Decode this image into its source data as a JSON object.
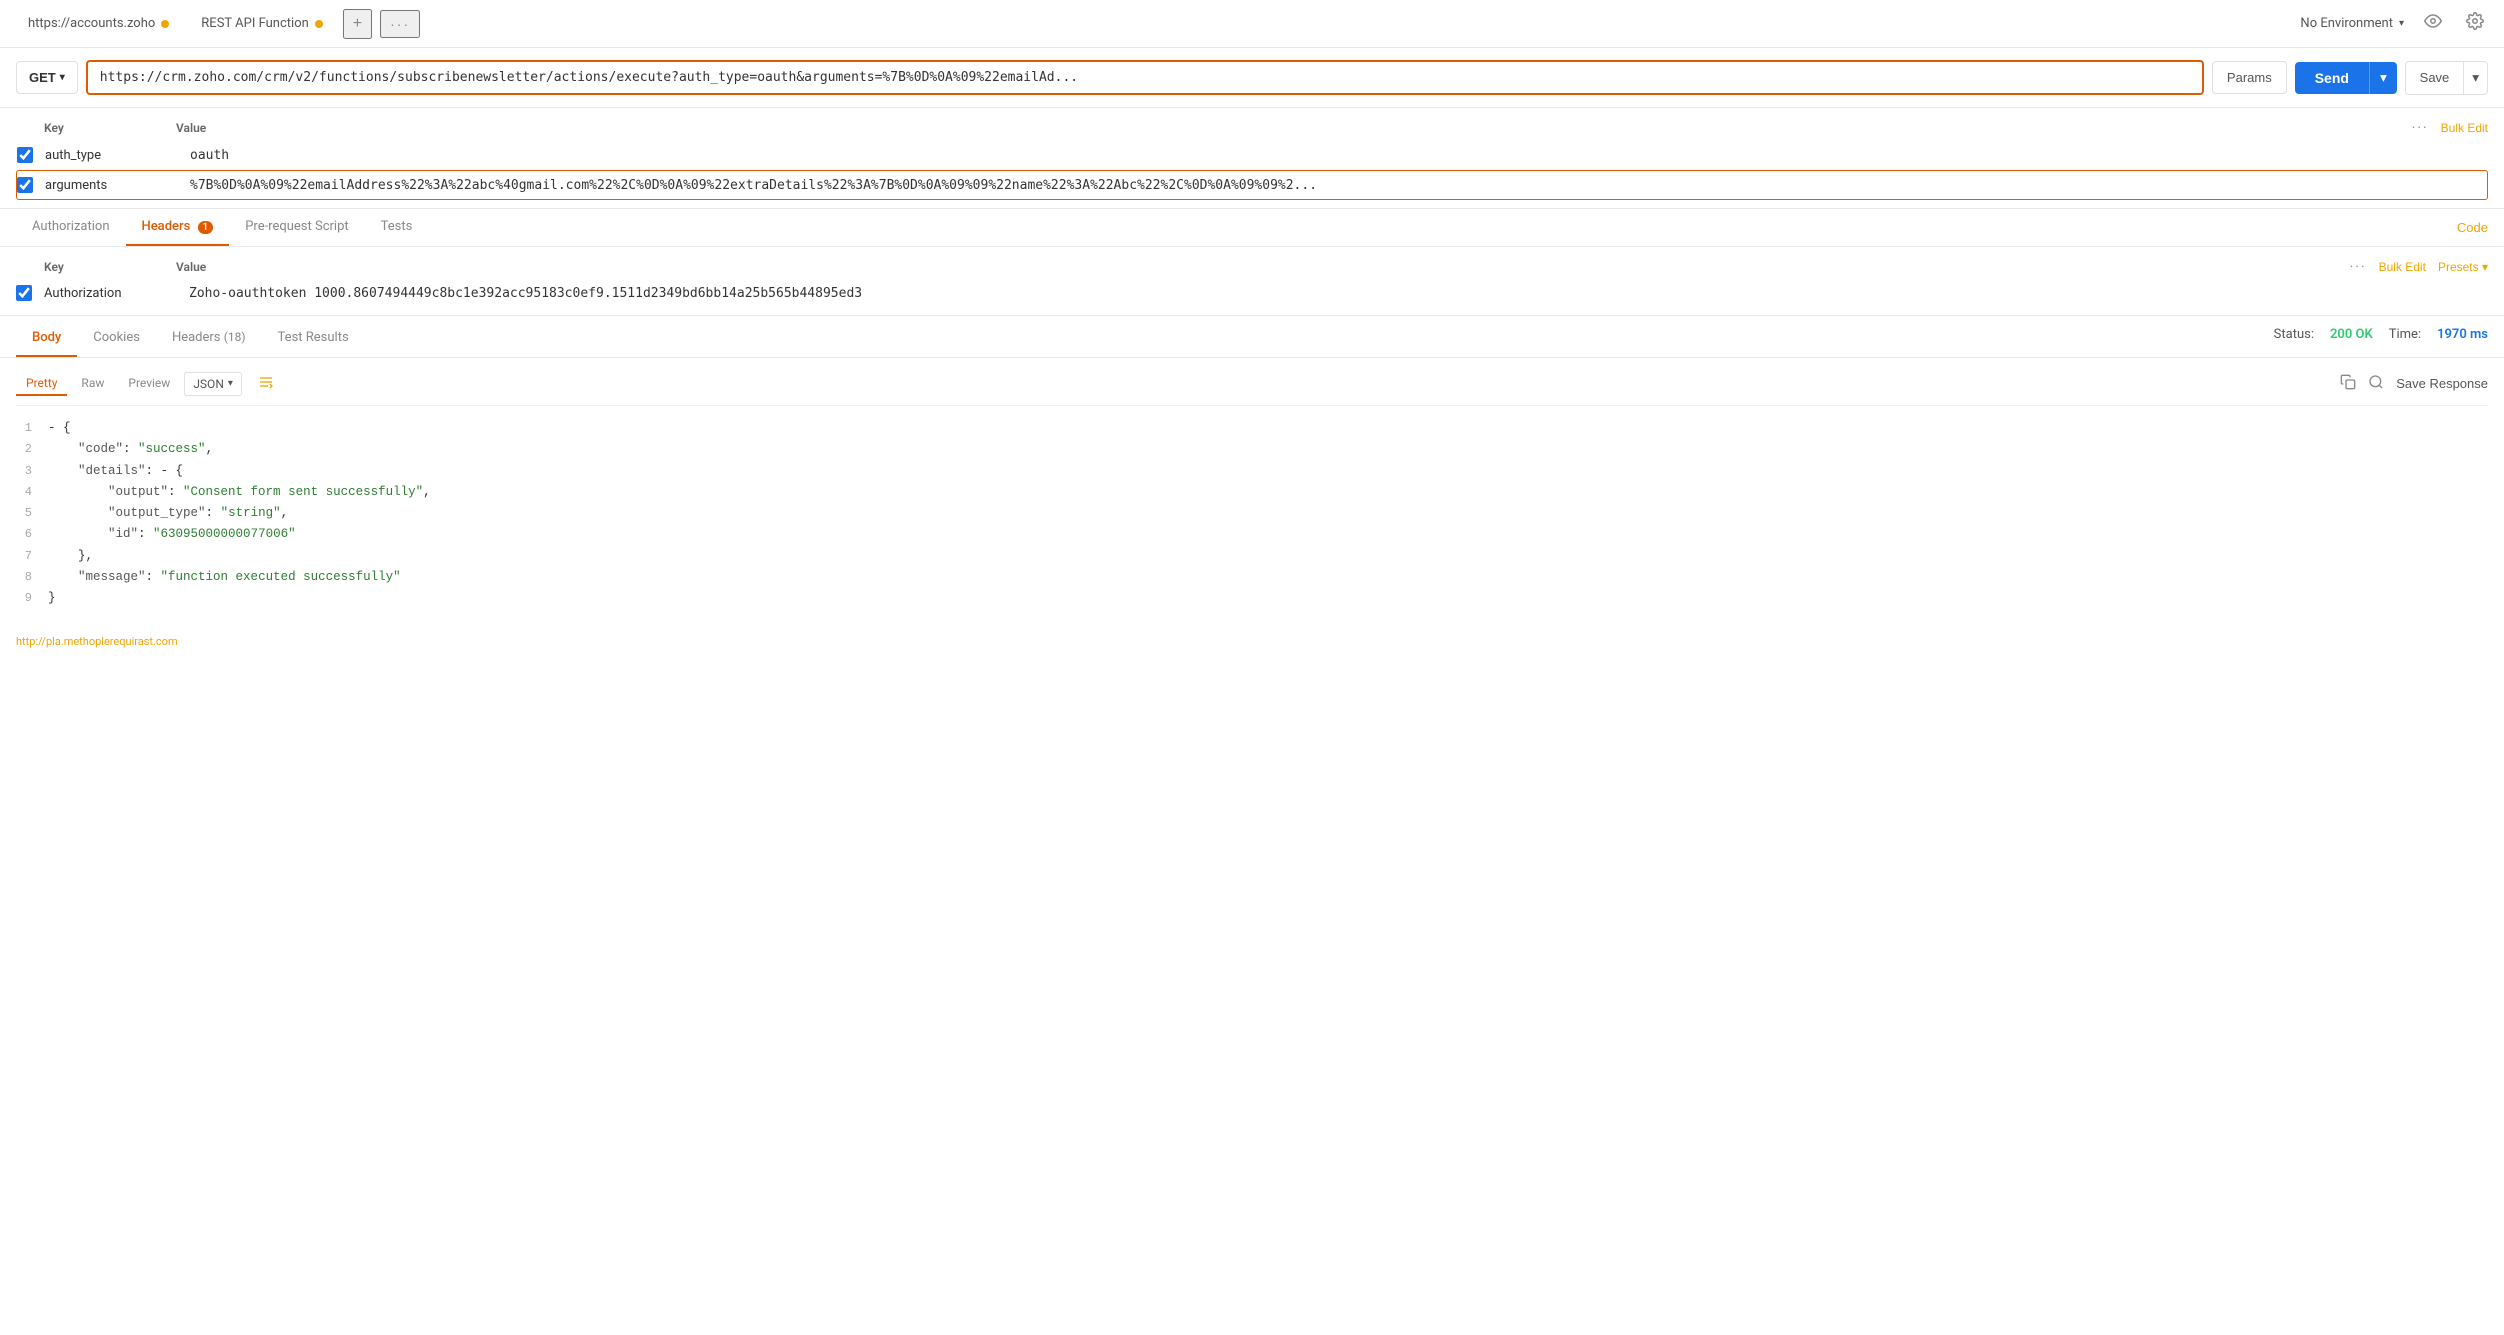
{
  "topBar": {
    "tab1": {
      "label": "https://accounts.zoho",
      "dotColor": "#f0a500"
    },
    "tab2": {
      "label": "REST API Function",
      "dotColor": "#f0a500"
    },
    "addIcon": "+",
    "moreIcon": "···",
    "envSelector": "No Environment",
    "eyeIcon": "👁",
    "gearIcon": "⚙"
  },
  "urlBar": {
    "method": "GET",
    "url": "https://crm.zoho.com/crm/v2/functions/subscribenewsletter/actions/execute?auth_type=oauth&arguments=%7B%0D%0A%09%22emailAd...",
    "paramsBtn": "Params",
    "sendBtn": "Send",
    "saveBtn": "Save"
  },
  "paramsTable": {
    "keyHeader": "Key",
    "valueHeader": "Value",
    "moreIcon": "···",
    "bulkEditBtn": "Bulk Edit",
    "rows": [
      {
        "checked": true,
        "key": "auth_type",
        "value": "oauth",
        "highlighted": false
      },
      {
        "checked": true,
        "key": "arguments",
        "value": "%7B%0D%0A%09%22emailAddress%22%3A%22abc%40gmail.com%22%2C%0D%0A%09%22extraDetails%22%3A%7B%0D%0A%09%09%22name%22%3A%22Abc%22%2C%0D%0A%09%09%2...",
        "highlighted": true
      }
    ]
  },
  "requestTabs": {
    "authorization": "Authorization",
    "headers": "Headers",
    "headersCount": "(1)",
    "preRequestScript": "Pre-request Script",
    "tests": "Tests",
    "activeTab": "headers",
    "codeBtn": "Code"
  },
  "headersTable": {
    "keyHeader": "Key",
    "valueHeader": "Value",
    "moreIcon": "···",
    "bulkEditBtn": "Bulk Edit",
    "presetsBtn": "Presets",
    "rows": [
      {
        "checked": true,
        "key": "Authorization",
        "value": "Zoho-oauthtoken 1000.8607494449c8bc1e392acc95183c0ef9.1511d2349bd6bb14a25b565b44895ed3"
      }
    ]
  },
  "responseTabs": {
    "body": "Body",
    "cookies": "Cookies",
    "headers": "Headers",
    "headersCount": "(18)",
    "testResults": "Test Results",
    "activeTab": "body",
    "statusLabel": "Status:",
    "statusValue": "200 OK",
    "timeLabel": "Time:",
    "timeValue": "1970 ms"
  },
  "responseFormatBar": {
    "pretty": "Pretty",
    "raw": "Raw",
    "preview": "Preview",
    "jsonFormat": "JSON",
    "wrapIcon": "≡",
    "copyIcon": "⧉",
    "searchIcon": "🔍",
    "saveResponse": "Save Response"
  },
  "codeLines": [
    {
      "num": "1",
      "content": "{",
      "type": "brace"
    },
    {
      "num": "2",
      "content": "    \"code\": \"success\",",
      "type": "keystring"
    },
    {
      "num": "3",
      "content": "    \"details\": {",
      "type": "keyobject"
    },
    {
      "num": "4",
      "content": "        \"output\": \"Consent form sent successfully\",",
      "type": "keystring"
    },
    {
      "num": "5",
      "content": "        \"output_type\": \"string\",",
      "type": "keystring"
    },
    {
      "num": "6",
      "content": "        \"id\": \"63095000000077006\"",
      "type": "keystring"
    },
    {
      "num": "7",
      "content": "    },",
      "type": "brace"
    },
    {
      "num": "8",
      "content": "    \"message\": \"function executed successfully\"",
      "type": "keystring"
    },
    {
      "num": "9",
      "content": "}",
      "type": "brace"
    }
  ],
  "footer": {
    "link": "http://pla.methoplerequirast.com"
  }
}
